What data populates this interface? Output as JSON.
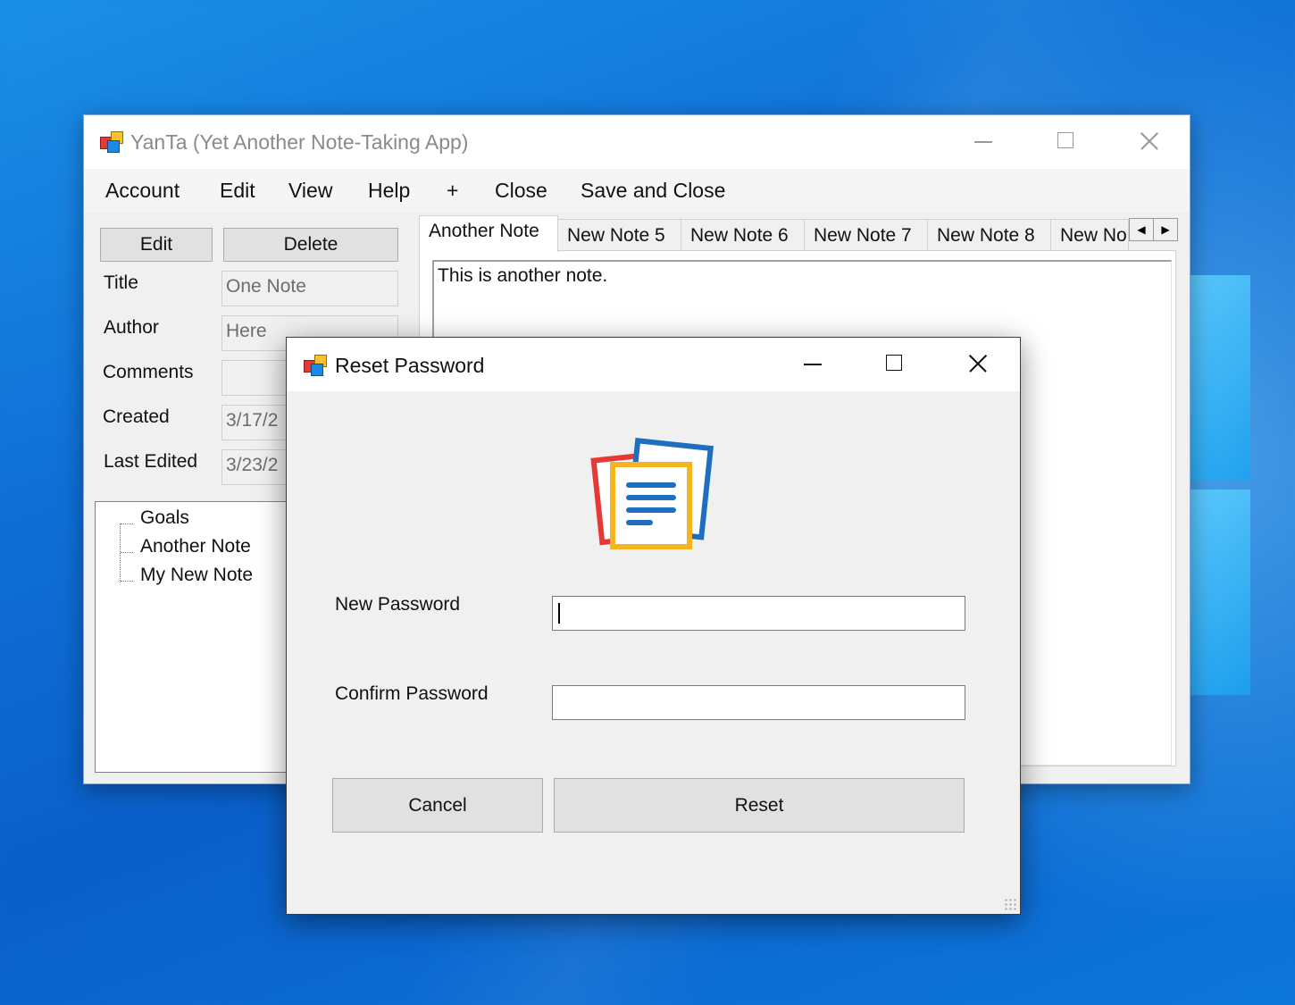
{
  "main_window": {
    "title": "YanTa (Yet Another Note-Taking App)",
    "menu": [
      "Account",
      "Edit",
      "View",
      "Help",
      "+",
      "Close",
      "Save and Close"
    ],
    "buttons": {
      "edit": "Edit",
      "delete": "Delete"
    },
    "fields": [
      {
        "label": "Title",
        "value": "One Note"
      },
      {
        "label": "Author",
        "value": "Here"
      },
      {
        "label": "Comments",
        "value": ""
      },
      {
        "label": "Created",
        "value": "3/17/2"
      },
      {
        "label": "Last Edited",
        "value": "3/23/2"
      }
    ],
    "tree_items": [
      "Goals",
      "Another Note",
      "My New Note"
    ],
    "tabs": [
      "Another Note",
      "New Note 5",
      "New Note 6",
      "New Note 7",
      "New Note 8",
      "New No"
    ],
    "active_tab": "Another Note",
    "note_text": "This is another note."
  },
  "dialog": {
    "title": "Reset Password",
    "new_password_label": "New Password",
    "confirm_password_label": "Confirm Password",
    "new_password_value": "",
    "confirm_password_value": "",
    "cancel_label": "Cancel",
    "reset_label": "Reset",
    "logo_icon": "notes-logo-icon"
  },
  "colors": {
    "desktop": "#0f6fd6",
    "logo_red": "#e53935",
    "logo_blue": "#1e6fc0",
    "logo_yellow": "#f6b51e"
  }
}
